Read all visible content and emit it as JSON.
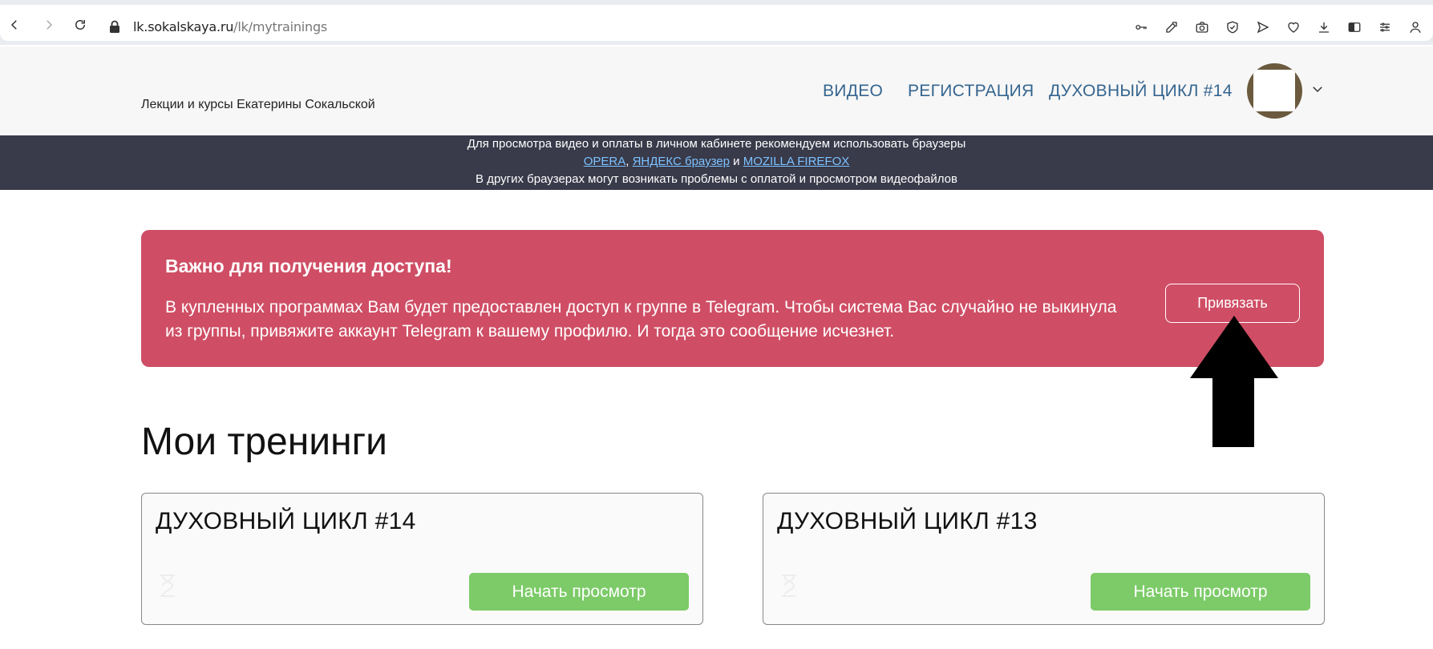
{
  "browser": {
    "url_domain": "lk.sokalskaya.ru",
    "url_path": "/lk/mytrainings"
  },
  "header": {
    "brand": "Лекции и курсы Екатерины Сокальской",
    "nav": [
      "ВИДЕО",
      "РЕГИСТРАЦИЯ",
      "ДУХОВНЫЙ ЦИКЛ #14"
    ]
  },
  "notice": {
    "line1": "Для просмотра видео и оплаты в личном кабинете рекомендуем использовать браузеры",
    "link_opera": "OPERA",
    "sep1": ", ",
    "link_yandex": "ЯНДЕКС браузер",
    "sep2": " и ",
    "link_firefox": "MOZILLA FIREFOX",
    "line3": "В других браузерах могут возникать проблемы с оплатой и просмотром видеофайлов"
  },
  "alert": {
    "title": "Важно для получения доступа!",
    "text": "В купленных программах Вам будет предоставлен доступ к группе в Telegram. Чтобы система Вас случайно не выкинула из группы, привяжите аккаунт Telegram к вашему профилю. И тогда это сообщение исчезнет.",
    "button": "Привязать",
    "bg_color": "#cf4e65"
  },
  "main": {
    "title": "Мои тренинги",
    "courses": [
      {
        "title": "ДУХОВНЫЙ ЦИКЛ #14",
        "button": "Начать просмотр"
      },
      {
        "title": "ДУХОВНЫЙ ЦИКЛ #13",
        "button": "Начать просмотр"
      }
    ],
    "button_color": "#7ccb68"
  }
}
